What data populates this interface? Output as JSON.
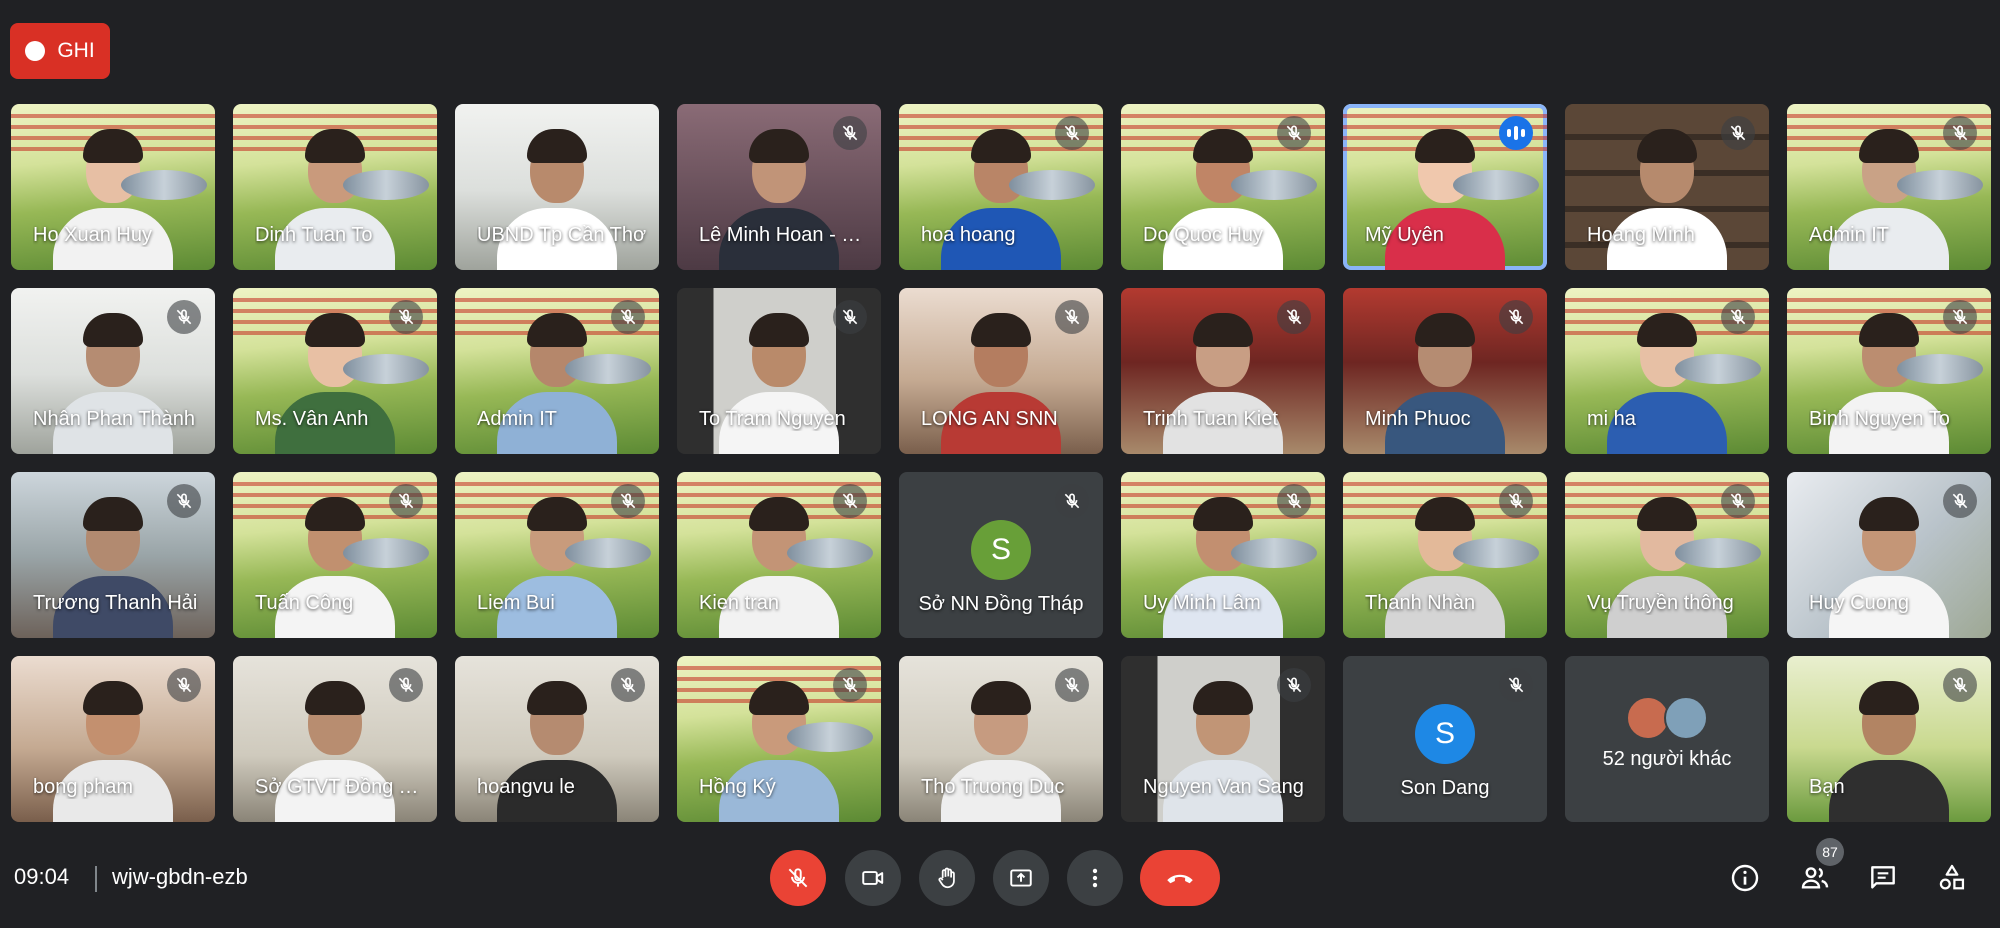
{
  "recording": {
    "label": "GHI"
  },
  "participants": [
    {
      "name": "Ho Xuan Huy",
      "muted": false,
      "bg": "bg-poster",
      "skin": "#e7bfa4",
      "shirt": "#f2f2f2"
    },
    {
      "name": "Dinh Tuan To",
      "muted": false,
      "bg": "bg-poster",
      "skin": "#c99a7c",
      "shirt": "#e9ecef"
    },
    {
      "name": "UBND Tp Cần Thơ",
      "muted": false,
      "bg": "bg-office",
      "skin": "#b88a6c",
      "shirt": "#ffffff"
    },
    {
      "name": "Lê Minh Hoan - BNN",
      "muted": true,
      "bg": "bg-dark",
      "skin": "#c19478",
      "shirt": "#2a2f3a"
    },
    {
      "name": "hoa hoang",
      "muted": true,
      "bg": "bg-poster",
      "skin": "#b98567",
      "shirt": "#1f57b5"
    },
    {
      "name": "Do Quoc Huy",
      "muted": true,
      "bg": "bg-poster",
      "skin": "#c08566",
      "shirt": "#ffffff"
    },
    {
      "name": "Mỹ Uyên",
      "muted": false,
      "speaking": true,
      "bg": "bg-poster",
      "skin": "#f0c8ad",
      "shirt": "#d92f4a"
    },
    {
      "name": "Hoang Minh",
      "muted": true,
      "bg": "bg-shelf",
      "skin": "#b68a6d",
      "shirt": "#ffffff"
    },
    {
      "name": "Admin IT",
      "muted": true,
      "bg": "bg-poster",
      "skin": "#c9a286",
      "shirt": "#e9ecef"
    },
    {
      "name": "Nhân Phan Thành",
      "muted": true,
      "bg": "bg-office",
      "skin": "#b58c72",
      "shirt": "#dfe3e6"
    },
    {
      "name": "Ms. Vân Anh",
      "muted": true,
      "bg": "bg-poster",
      "skin": "#e8c0a4",
      "shirt": "#3f6f3e"
    },
    {
      "name": "Admin IT",
      "muted": true,
      "bg": "bg-poster",
      "skin": "#b5876b",
      "shirt": "#8fb1d6"
    },
    {
      "name": "To Tram Nguyen",
      "muted": true,
      "bg": "bg-side",
      "skin": "#b98a6a",
      "shirt": "#f5f5f5"
    },
    {
      "name": "LONG AN SNN",
      "muted": true,
      "bg": "bg-meeting",
      "skin": "#b47d60",
      "shirt": "#b83a34"
    },
    {
      "name": "Trinh Tuan Kiet",
      "muted": true,
      "bg": "bg-red",
      "skin": "#c89e84",
      "shirt": "#e2e2e2"
    },
    {
      "name": "Minh Phuoc",
      "muted": true,
      "bg": "bg-red",
      "skin": "#b58c72",
      "shirt": "#38577e"
    },
    {
      "name": "mi ha",
      "muted": true,
      "bg": "bg-poster",
      "skin": "#e7c0a5",
      "shirt": "#2c5eb1"
    },
    {
      "name": "Binh Nguyen To",
      "muted": true,
      "bg": "bg-poster",
      "skin": "#bb8d70",
      "shirt": "#f3f3f3"
    },
    {
      "name": "Trương Thanh Hải",
      "muted": true,
      "bg": "bg-room",
      "skin": "#b28a70",
      "shirt": "#3f4a66"
    },
    {
      "name": "Tuấn Công",
      "muted": true,
      "bg": "bg-poster",
      "skin": "#c1906f",
      "shirt": "#f4f4f4"
    },
    {
      "name": "Liem Bui",
      "muted": true,
      "bg": "bg-poster",
      "skin": "#c89b7c",
      "shirt": "#9dbde0"
    },
    {
      "name": "Kien tran",
      "muted": true,
      "bg": "bg-poster",
      "skin": "#c39476",
      "shirt": "#f2f2f2"
    },
    {
      "name": "Sở NN Đồng Tháp",
      "muted": true,
      "avatar": "S",
      "avatarColor": "#689f38"
    },
    {
      "name": "Uy Minh Lâm",
      "muted": true,
      "bg": "bg-poster",
      "skin": "#c28f70",
      "shirt": "#dfe6f1"
    },
    {
      "name": "Thanh Nhàn",
      "muted": true,
      "bg": "bg-poster",
      "skin": "#e3b999",
      "shirt": "#d5d5d5"
    },
    {
      "name": "Vụ Truyền thông",
      "muted": true,
      "bg": "bg-poster",
      "skin": "#e2b99f",
      "shirt": "#cfcfcf"
    },
    {
      "name": "Huy Cuong",
      "muted": true,
      "bg": "bg-map",
      "skin": "#c49677",
      "shirt": "#f5f5f5"
    },
    {
      "name": "bong pham",
      "muted": true,
      "bg": "bg-meeting",
      "skin": "#c3906f",
      "shirt": "#e9e9e9"
    },
    {
      "name": "Sở GTVT Đồng Tháp",
      "muted": true,
      "bg": "bg-wall",
      "skin": "#b88d70",
      "shirt": "#f3f3f3"
    },
    {
      "name": "hoangvu le",
      "muted": true,
      "bg": "bg-wall",
      "skin": "#b58b70",
      "shirt": "#2b2b2b"
    },
    {
      "name": "Hồng Ký",
      "muted": true,
      "bg": "bg-poster",
      "skin": "#c99a7b",
      "shirt": "#9ab8d8"
    },
    {
      "name": "Tho Truong Duc",
      "muted": true,
      "bg": "bg-wall",
      "skin": "#c69b80",
      "shirt": "#eeeeee"
    },
    {
      "name": "Nguyen Van Sang",
      "muted": true,
      "bg": "bg-side",
      "skin": "#c19576",
      "shirt": "#dfe4ea"
    },
    {
      "name": "Son Dang",
      "muted": true,
      "avatar": "S",
      "avatarColor": "#1e88e5"
    },
    {
      "name": "52 người khác",
      "others": true,
      "muted": false
    },
    {
      "name": "Bạn",
      "muted": true,
      "bg": "bg-ban",
      "skin": "#b28463",
      "shirt": "#2f2f2f"
    }
  ],
  "bottombar": {
    "time": "09:04",
    "meeting_code": "wjw-gbdn-ezb",
    "participant_count": "87"
  },
  "colors": {
    "background": "#202124",
    "tile": "#3c4043",
    "danger": "#ea4335",
    "speaking": "#8ab4f8"
  },
  "icons": {
    "mic_off": "mic-off-icon",
    "camera": "video-camera-icon",
    "hand": "raise-hand-icon",
    "present": "present-screen-icon",
    "more": "more-options-icon",
    "hangup": "hang-up-icon",
    "info": "info-icon",
    "people": "people-icon",
    "chat": "chat-icon",
    "activities": "activities-icon"
  }
}
